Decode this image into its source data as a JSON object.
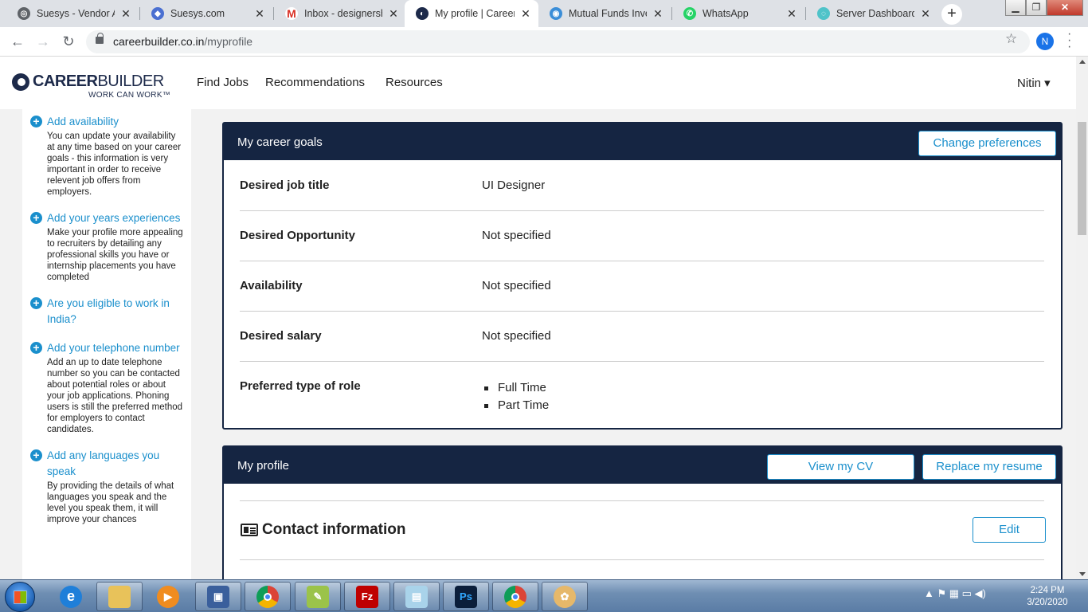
{
  "browser": {
    "tabs": [
      {
        "title": "Suesys - Vendor Ac",
        "icon": "generic-globe-icon",
        "color": "#5f6368"
      },
      {
        "title": "Suesys.com",
        "icon": "suesys-icon",
        "color": "#4a6fd1"
      },
      {
        "title": "Inbox - designersh",
        "icon": "gmail-icon",
        "color": "#d93025"
      },
      {
        "title": "My profile | Career",
        "icon": "careerbuilder-icon",
        "color": "#1d2a4a",
        "active": true
      },
      {
        "title": "Mutual Funds Inves",
        "icon": "mutual-funds-icon",
        "color": "#3b8ed8"
      },
      {
        "title": "WhatsApp",
        "icon": "whatsapp-icon",
        "color": "#25d366"
      },
      {
        "title": "Server Dashboard",
        "icon": "server-dashboard-icon",
        "color": "#4fc3c9"
      }
    ],
    "close_glyph": "✕",
    "new_tab_glyph": "+",
    "url_host": "careerbuilder.co.in",
    "url_path": "/myprofile",
    "profile_initial": "N"
  },
  "site": {
    "logo_text_bold": "CAREER",
    "logo_text_light": "BUILDER",
    "logo_tagline": "WORK CAN WORK™",
    "nav": [
      "Find Jobs",
      "Recommendations",
      "Resources"
    ],
    "user_name": "Nitin ▾"
  },
  "sidebar": {
    "items": [
      {
        "link": "Add availability",
        "desc": "You can update your availability at any time based on your career goals - this information is very important in order to receive relevent job offers from employers."
      },
      {
        "link": "Add your years experiences",
        "desc": "Make your profile more appealing to recruiters by detailing any professional skills you have or internship placements you have completed"
      },
      {
        "link": "Are you eligible to work in India?",
        "desc": ""
      },
      {
        "link": "Add your telephone number",
        "desc": "Add an up to date telephone number so you can be contacted about potential roles or about your job applications. Phoning users is still the preferred method for employers to contact candidates."
      },
      {
        "link": "Add any languages you speak",
        "desc": "By providing the details of what languages you speak and the level you speak them, it will improve your chances"
      }
    ]
  },
  "career_goals": {
    "title": "My career goals",
    "change_button": "Change preferences",
    "rows": [
      {
        "label": "Desired job title",
        "value": "UI Designer"
      },
      {
        "label": "Desired Opportunity",
        "value": "Not specified"
      },
      {
        "label": "Availability",
        "value": "Not specified"
      },
      {
        "label": "Desired salary",
        "value": "Not specified"
      },
      {
        "label": "Preferred type of role",
        "values": [
          "Full Time",
          "Part Time"
        ]
      }
    ]
  },
  "my_profile": {
    "title": "My profile",
    "view_cv_button": "View my CV",
    "replace_resume_button": "Replace my resume",
    "contact_title": "Contact information",
    "edit_button": "Edit"
  },
  "taskbar": {
    "apps": [
      "ie-icon",
      "explorer-icon",
      "media-player-icon",
      "network-icon",
      "chrome-icon",
      "notepad-plus-icon",
      "filezilla-icon",
      "notepad-icon",
      "photoshop-icon",
      "chrome-icon",
      "paint-icon"
    ],
    "photoshop_label": "Ps",
    "filezilla_label": "Fz",
    "time": "2:24 PM",
    "date": "3/20/2020"
  },
  "colors": {
    "navy": "#152542",
    "link_blue": "#1a8fcc",
    "page_bg": "#f2f2f2"
  }
}
